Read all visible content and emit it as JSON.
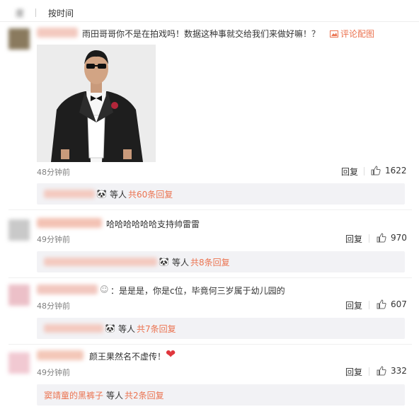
{
  "colors": {
    "accent": "#eb7350",
    "reply_bg": "#f2f2f5",
    "time": "#808080"
  },
  "sort": {
    "hot_label": "度",
    "time_label": "按时间"
  },
  "comments": [
    {
      "text": "雨田哥哥你不是在拍戏吗！数据这种事就交给我们来做好嘛！？",
      "photo_link": "评论配图",
      "time": "48分钟前",
      "reply_label": "回复",
      "likes": "1622",
      "reply_suffix": "等人",
      "reply_count": "共60条回复"
    },
    {
      "text": "哈哈哈哈哈哈支持帅雷雷",
      "time": "49分钟前",
      "reply_label": "回复",
      "likes": "970",
      "reply_suffix": "等人",
      "reply_count": "共8条回复"
    },
    {
      "text": "：是是是，你是c位，毕竟何三岁属于幼儿园的",
      "time": "48分钟前",
      "reply_label": "回复",
      "likes": "607",
      "reply_suffix": "等人",
      "reply_count": "共7条回复"
    },
    {
      "text": "颜王果然名不虚传！",
      "time": "49分钟前",
      "reply_label": "回复",
      "likes": "332",
      "reply_user": "窦靖童的黑裤子",
      "reply_suffix": "等人",
      "reply_count": "共2条回复"
    }
  ],
  "icons": {
    "thumb": "thumbs-up-icon",
    "photo": "image-icon",
    "heart": "heart-icon",
    "panda": "panda-emoji-icon"
  }
}
